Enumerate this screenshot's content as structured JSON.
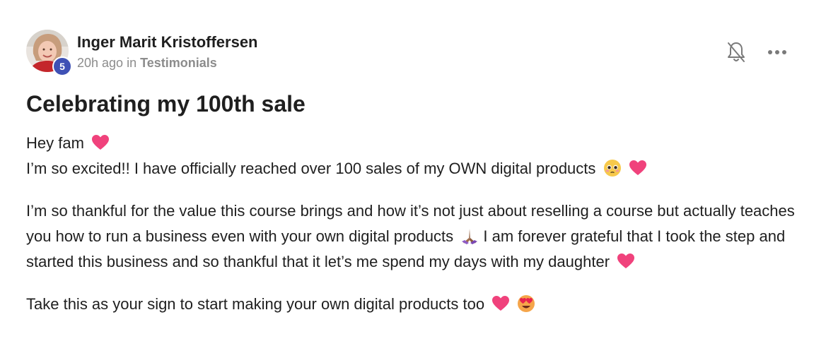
{
  "author": {
    "name": "Inger Marit Kristoffersen",
    "level": "5",
    "time_ago": "20h ago",
    "in_text": "in",
    "category": "Testimonials"
  },
  "post": {
    "title": "Celebrating my 100th sale",
    "paragraph1_line1": "Hey fam",
    "paragraph1_line2": "I’m so excited!! I have officially reached over 100 sales of my OWN digital products",
    "paragraph2_part1": "I’m so thankful for the value this course brings and how it’s not just about reselling a course but actually teaches you how to run a business even with your own digital products",
    "paragraph2_part2": "I am forever grateful that I took the step and started this business and so thankful that it let’s me spend my days with my daughter",
    "paragraph3": "Take this as your sign to start making your own digital products too"
  },
  "icons": {
    "notification": "bell-off-icon",
    "menu": "more-horizontal-icon"
  },
  "colors": {
    "badge": "#3f51b5",
    "heart": "#f0427c",
    "muted_text": "#8c8c8c"
  }
}
